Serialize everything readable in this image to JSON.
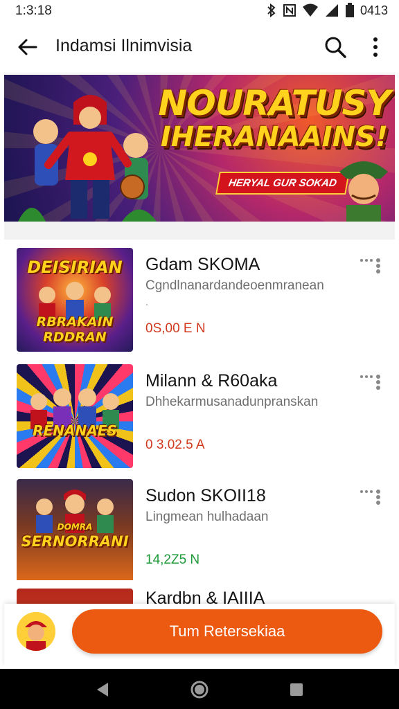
{
  "status_bar": {
    "time": "1:3:18",
    "battery_text": "0413"
  },
  "app_bar": {
    "title": "Indamsi Ilnimvisia",
    "icons": [
      "back-arrow-icon",
      "search-icon",
      "more-vert-icon"
    ]
  },
  "banner": {
    "headline_line1": "NOURATUSY",
    "headline_line2": "IHERANAAINS!",
    "tag": "HERYAL GUR SOKAD"
  },
  "items": [
    {
      "thumb_title_top": "DEISIRIAN",
      "thumb_title_bottom": "RBRAKAIN RDDRAN",
      "name": "Gdam SKOMA",
      "description": "Cgndlnanardandeoenmranean",
      "dot": ".",
      "price": "0S,00 E N",
      "price_color": "#d23a1e"
    },
    {
      "thumb_title_top": "",
      "thumb_title_bottom": "RENANAES",
      "name": "Milann & R60aka",
      "description": "Dhhekarmusanadunpranskan",
      "dot": "",
      "price": "0 3.02.5 A",
      "price_color": "#d23a1e"
    },
    {
      "thumb_title_top": "DOMRA",
      "thumb_title_bottom": "SERNORRANI",
      "name": "Sudon SKOII18",
      "description": "Lingmean hulhadaan",
      "dot": "",
      "price": "14,2Z5 N",
      "price_color": "#1f9a3a"
    },
    {
      "thumb_title_top": "",
      "thumb_title_bottom": "",
      "name": "Kardbn & IAIIIA",
      "description": "",
      "dot": "",
      "price": "",
      "price_color": "#d23a1e"
    }
  ],
  "action_bar": {
    "button_label": "Tum Retersekiaa",
    "button_color": "#ec5a12"
  },
  "nav_bar": {
    "icons": [
      "back-triangle-icon",
      "home-circle-icon",
      "recents-square-icon"
    ]
  }
}
